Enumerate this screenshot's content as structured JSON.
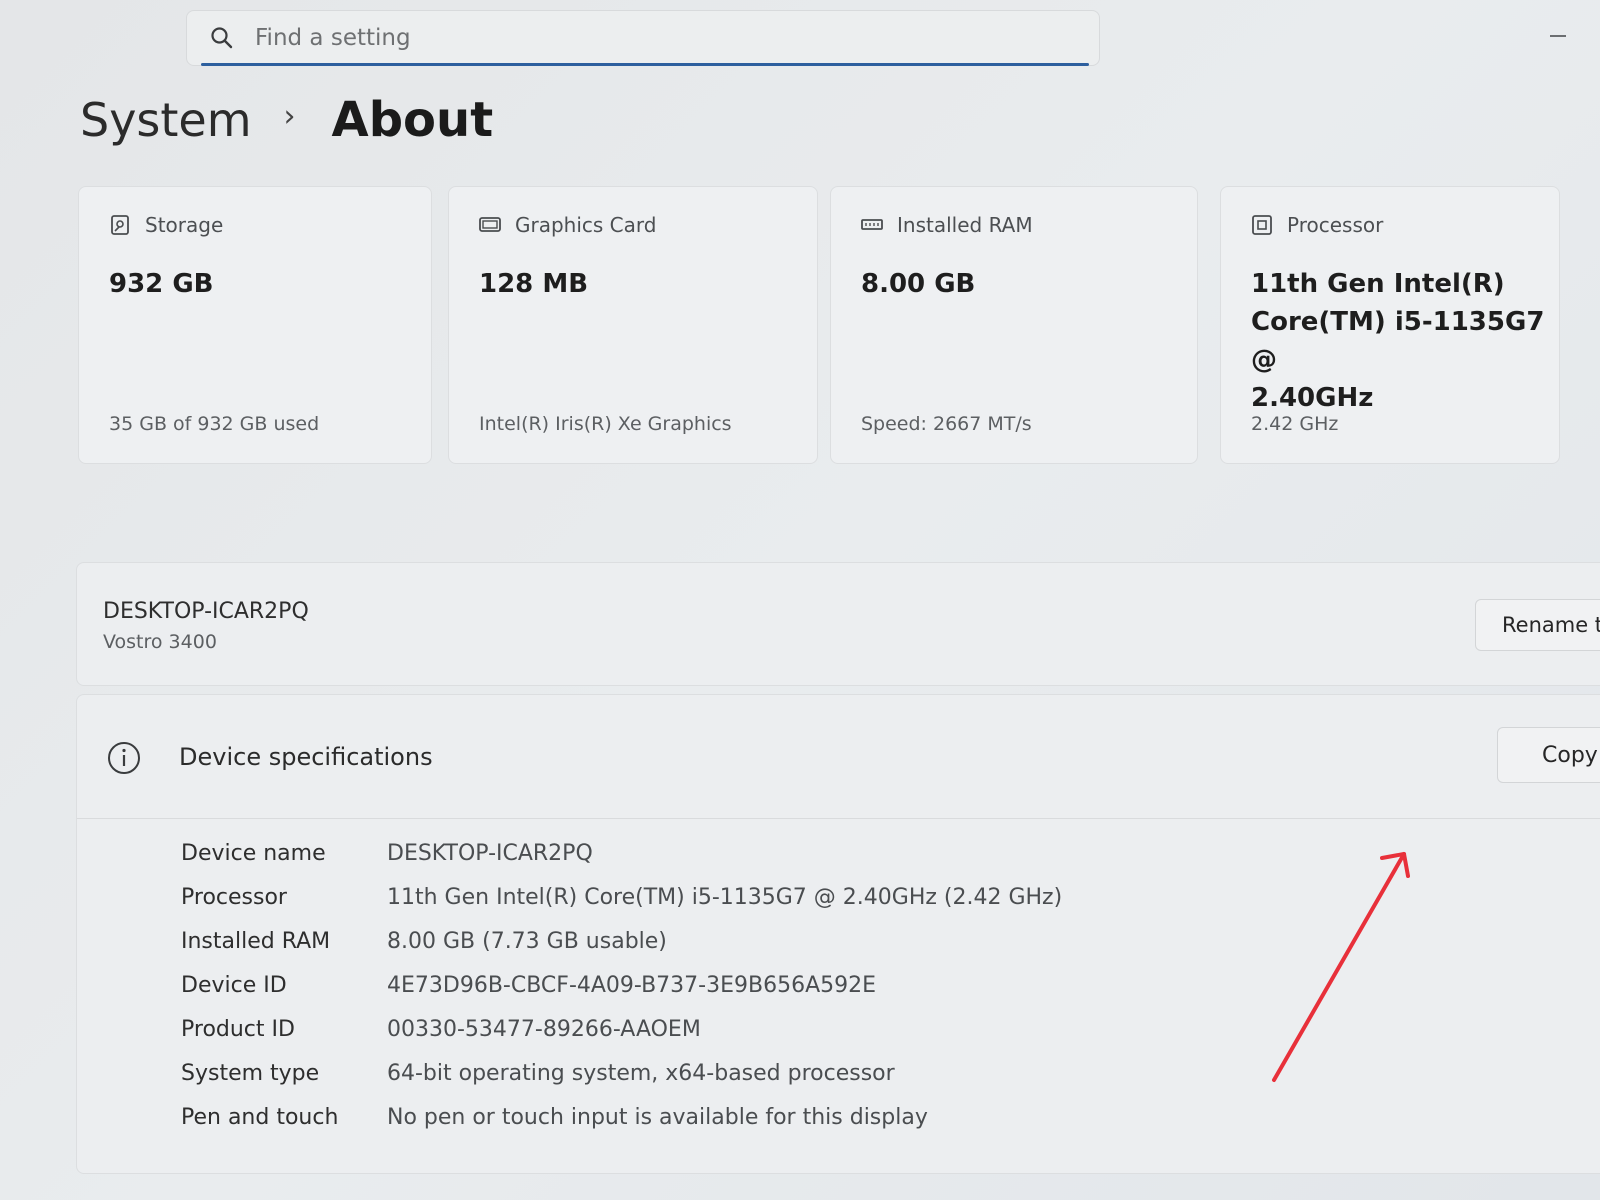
{
  "search": {
    "placeholder": "Find a setting"
  },
  "breadcrumb": {
    "parent": "System",
    "separator": "›",
    "current": "About"
  },
  "cards": [
    {
      "icon": "storage-icon",
      "label": "Storage",
      "value": "932 GB",
      "sub": "35 GB of 932 GB used"
    },
    {
      "icon": "graphics-card-icon",
      "label": "Graphics Card",
      "value": "128 MB",
      "sub": "Intel(R) Iris(R) Xe Graphics"
    },
    {
      "icon": "ram-icon",
      "label": "Installed RAM",
      "value": "8.00 GB",
      "sub": "Speed: 2667 MT/s"
    },
    {
      "icon": "processor-icon",
      "label": "Processor",
      "value_lines": [
        "11th Gen Intel(R)",
        "Core(TM) i5-1135G7 @",
        "2.40GHz"
      ],
      "sub": "2.42 GHz"
    }
  ],
  "device": {
    "name": "DESKTOP-ICAR2PQ",
    "model": "Vostro 3400",
    "rename_label": "Rename t"
  },
  "specs": {
    "title": "Device specifications",
    "copy_label": "Copy",
    "rows": [
      {
        "key": "Device name",
        "value": "DESKTOP-ICAR2PQ"
      },
      {
        "key": "Processor",
        "value": "11th Gen Intel(R) Core(TM) i5-1135G7 @ 2.40GHz (2.42 GHz)"
      },
      {
        "key": "Installed RAM",
        "value": "8.00 GB (7.73 GB usable)"
      },
      {
        "key": "Device ID",
        "value": "4E73D96B-CBCF-4A09-B737-3E9B656A592E"
      },
      {
        "key": "Product ID",
        "value": "00330-53477-89266-AAOEM"
      },
      {
        "key": "System type",
        "value": "64-bit operating system, x64-based processor"
      },
      {
        "key": "Pen and touch",
        "value": "No pen or touch input is available for this display"
      }
    ]
  },
  "colors": {
    "accent": "#2d5f9e",
    "annotation": "#e8303a"
  }
}
